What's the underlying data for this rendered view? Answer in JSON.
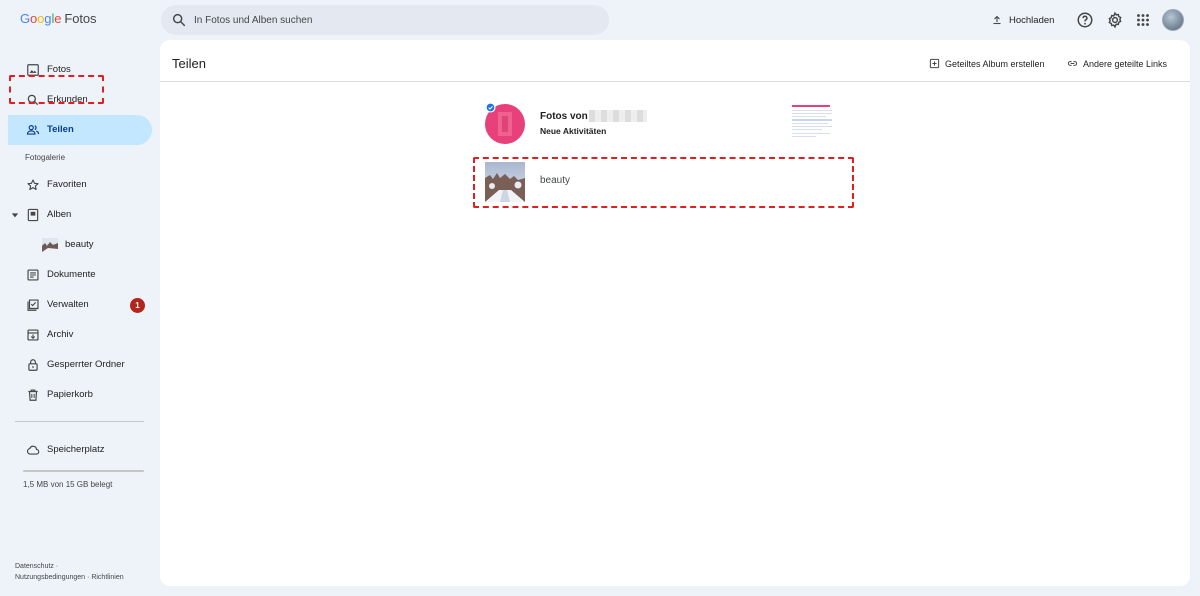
{
  "app": {
    "logo_google": "Google",
    "logo_product": "Fotos"
  },
  "search": {
    "placeholder": "In Fotos und Alben suchen"
  },
  "topbar": {
    "upload_label": "Hochladen",
    "icons": [
      "upload-icon",
      "help-icon",
      "settings-icon",
      "apps-grid-icon",
      "account-avatar"
    ]
  },
  "sidebar": {
    "items": [
      {
        "label": "Fotos",
        "icon": "photo-icon"
      },
      {
        "label": "Erkunden",
        "icon": "search-icon"
      },
      {
        "label": "Teilen",
        "icon": "people-icon",
        "active": true
      },
      {
        "label": "Favoriten",
        "icon": "star-icon"
      },
      {
        "label": "Alben",
        "icon": "album-icon",
        "expanded": true
      },
      {
        "label": "beauty",
        "icon": "album-thumbnail"
      },
      {
        "label": "Dokumente",
        "icon": "document-icon"
      },
      {
        "label": "Verwalten",
        "icon": "manage-icon",
        "badge": "1"
      },
      {
        "label": "Archiv",
        "icon": "archive-icon"
      },
      {
        "label": "Gesperrter Ordner",
        "icon": "lock-icon"
      },
      {
        "label": "Papierkorb",
        "icon": "trash-icon"
      },
      {
        "label": "Speicherplatz",
        "icon": "cloud-icon"
      }
    ],
    "section_label": "Fotogalerie",
    "storage_text": "1,5 MB von 15 GB belegt",
    "storage_fraction": 0.0001,
    "footer": {
      "privacy": "Datenschutz",
      "separator": "·",
      "terms": "Nutzungsbedingungen",
      "policies": "Richtlinien"
    }
  },
  "main": {
    "title": "Teilen",
    "actions": {
      "create_shared_album": "Geteiltes Album erstellen",
      "other_links": "Andere geteilte Links"
    },
    "shares": [
      {
        "title": "Fotos von",
        "subtitle": "Neue Aktivitäten",
        "thumb": "pink-avatar"
      },
      {
        "title": "beauty",
        "thumb": "winter-street-photo"
      }
    ]
  },
  "colors": {
    "accent": "#0b57d0",
    "active_nav": "#c2e7ff",
    "badge": "#b3261e",
    "annotation": "#e02020",
    "avatar_pink": "#e8407a"
  }
}
